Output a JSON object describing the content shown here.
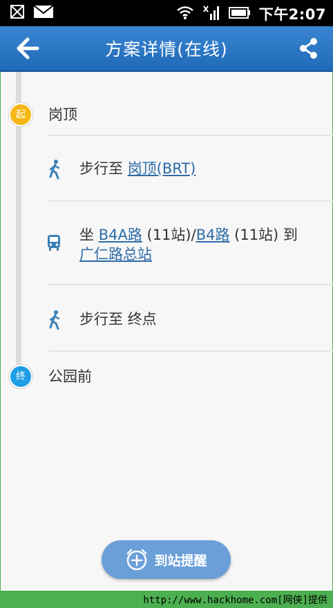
{
  "status_bar": {
    "time": "下午2:07",
    "icons": [
      "sim-icon",
      "mail-icon",
      "wifi-icon",
      "signal-icon",
      "battery-icon"
    ]
  },
  "header": {
    "title": "方案详情(在线)",
    "back_icon": "arrow-left-icon",
    "share_icon": "share-icon",
    "background": "#2a78c8"
  },
  "route": {
    "start": {
      "badge": "起",
      "name": "岗顶",
      "color": "#f5b716"
    },
    "steps": [
      {
        "icon": "walk-icon",
        "prefix": "步行至 ",
        "link": "岗顶(BRT)"
      },
      {
        "icon": "bus-icon",
        "prefix": "坐 ",
        "link1": "B4A路",
        "mid1": " (11站)/",
        "link2": "B4路",
        "mid2": " (11站) 到",
        "link3": "广仁路总站"
      },
      {
        "icon": "walk-icon",
        "text": "步行至 终点"
      }
    ],
    "end": {
      "badge": "终",
      "name": "公园前",
      "color": "#1f9ee6"
    }
  },
  "reminder_button": {
    "label": "到站提醒",
    "icon": "alarm-clock-plus-icon"
  },
  "footer": {
    "watermark": "http://www.hackhome.com[网侠]提供"
  }
}
